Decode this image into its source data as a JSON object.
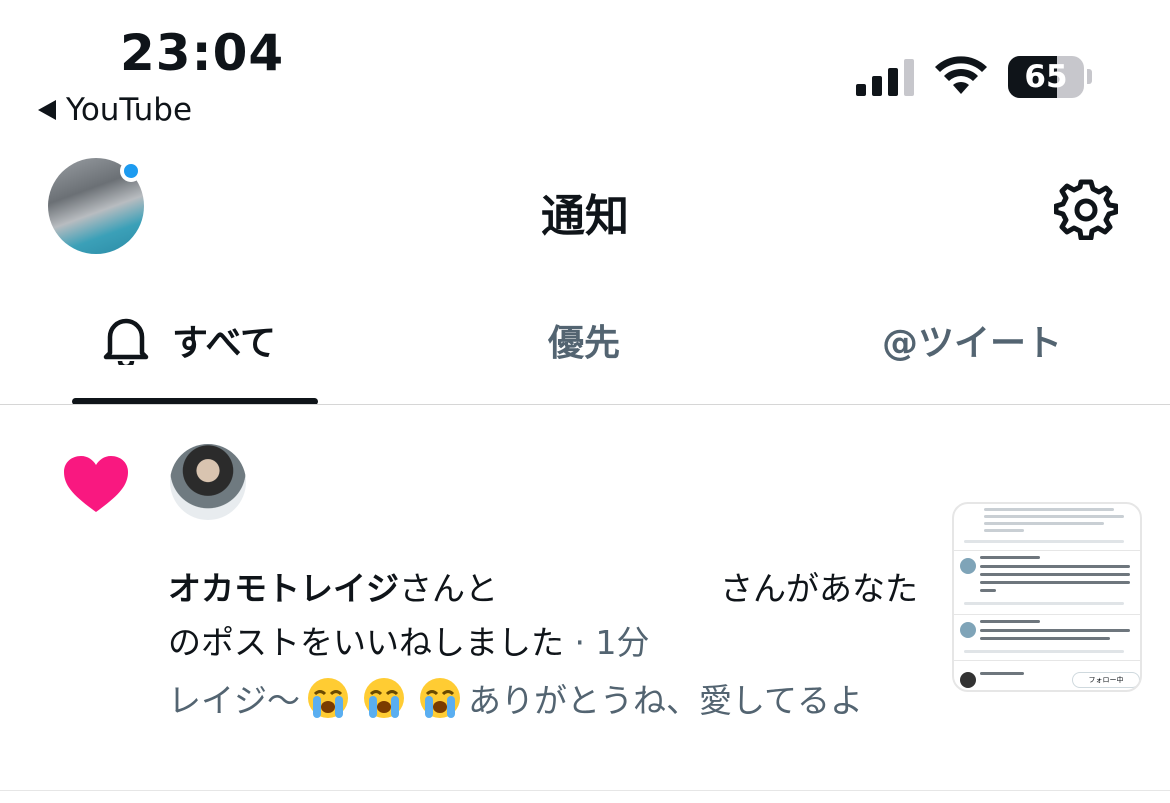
{
  "status_bar": {
    "time": "23:04",
    "back_label": "YouTube",
    "battery_percent": "65"
  },
  "header": {
    "title": "通知",
    "avatar_has_indicator": true,
    "indicator_color": "#1d9bf0"
  },
  "tabs": [
    {
      "label": "すべて",
      "active": true
    },
    {
      "label": "優先",
      "active": false
    },
    {
      "label": "@ツイート",
      "active": false
    }
  ],
  "notification": {
    "type_icon": "heart-icon",
    "icon_color": "#f91880",
    "actor_name": "オカモトレイジ",
    "text_part1": "さんと",
    "text_part2": "さんがあなたのポストをいいねしました",
    "time": " · 1分",
    "quote_start": "レイジ〜",
    "quote_end": "ありがとうね、愛してるよ",
    "emoji_name": "loudly-crying-face-emoji"
  },
  "thumbnail": {
    "follow_label": "フォロー中",
    "author_label": "オカモトレイジ",
    "tweet_user": "towa"
  },
  "colors": {
    "accent": "#1d9bf0",
    "like": "#f91880",
    "text": "#0f1419",
    "secondary": "#536471"
  }
}
